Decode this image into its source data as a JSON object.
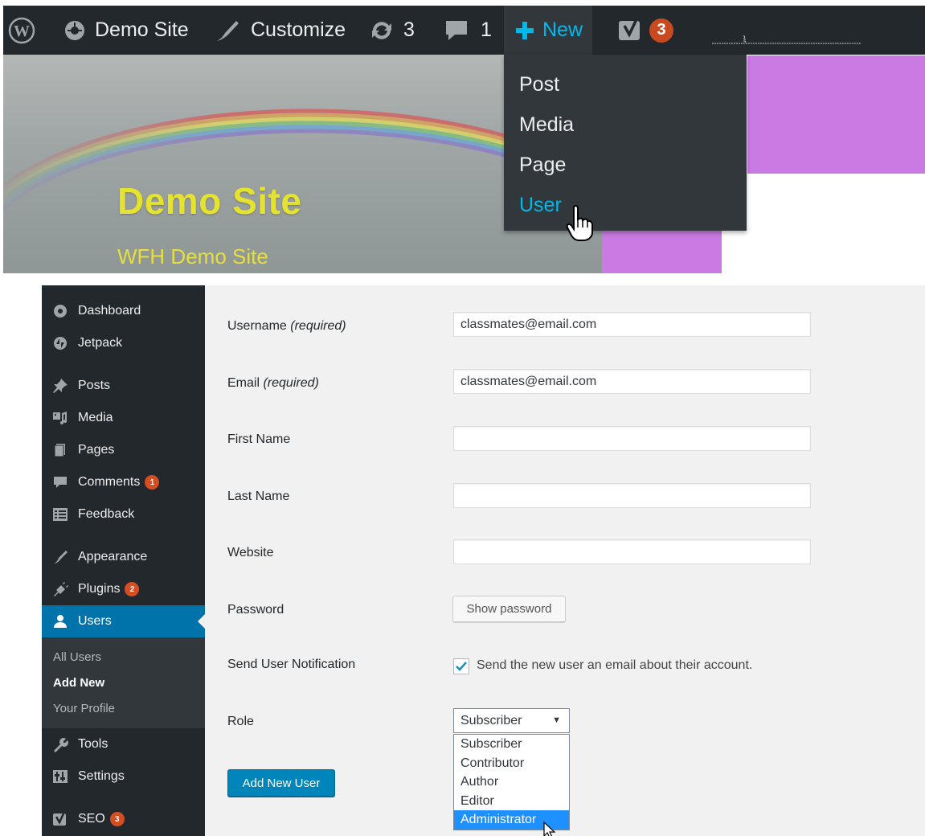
{
  "admin_bar": {
    "site_name": "Demo Site",
    "customize": "Customize",
    "updates_count": "3",
    "comments_count": "1",
    "new_label": "New",
    "seo_badge": "3",
    "new_menu": [
      "Post",
      "Media",
      "Page",
      "User"
    ],
    "active_item": "User"
  },
  "header": {
    "site_title": "Demo Site",
    "tagline": "WFH Demo Site"
  },
  "sidebar": {
    "items": [
      {
        "label": "Dashboard",
        "icon": "dashboard-icon"
      },
      {
        "label": "Jetpack",
        "icon": "jetpack-icon"
      },
      {
        "label": "Posts",
        "icon": "pin-icon"
      },
      {
        "label": "Media",
        "icon": "media-icon"
      },
      {
        "label": "Pages",
        "icon": "pages-icon"
      },
      {
        "label": "Comments",
        "icon": "comment-icon",
        "badge": "1"
      },
      {
        "label": "Feedback",
        "icon": "feedback-icon"
      },
      {
        "label": "Appearance",
        "icon": "brush-icon"
      },
      {
        "label": "Plugins",
        "icon": "plugin-icon",
        "badge": "2"
      },
      {
        "label": "Users",
        "icon": "users-icon"
      },
      {
        "label": "Tools",
        "icon": "wrench-icon"
      },
      {
        "label": "Settings",
        "icon": "settings-icon"
      },
      {
        "label": "SEO",
        "icon": "yoast-icon",
        "badge": "3"
      }
    ],
    "active": "Users",
    "submenu": [
      "All Users",
      "Add New",
      "Your Profile"
    ],
    "submenu_current": "Add New"
  },
  "form": {
    "username_label": "Username",
    "username_req": "(required)",
    "username_value": "classmates@email.com",
    "email_label": "Email",
    "email_req": "(required)",
    "email_value": "classmates@email.com",
    "first_name_label": "First Name",
    "last_name_label": "Last Name",
    "website_label": "Website",
    "password_label": "Password",
    "show_password": "Show password",
    "notification_label": "Send User Notification",
    "notification_text": "Send the new user an email about their account.",
    "notification_checked": true,
    "role_label": "Role",
    "role_selected": "Subscriber",
    "role_options": [
      "Subscriber",
      "Contributor",
      "Author",
      "Editor",
      "Administrator"
    ],
    "role_highlighted": "Administrator",
    "submit_label": "Add New User"
  },
  "colors": {
    "admin_bar": "#23282d",
    "accent_blue": "#00b9eb",
    "wp_blue": "#0073aa",
    "badge_orange": "#d54e21",
    "header_purple": "#c97ae3",
    "title_yellow": "#e6e32f"
  }
}
